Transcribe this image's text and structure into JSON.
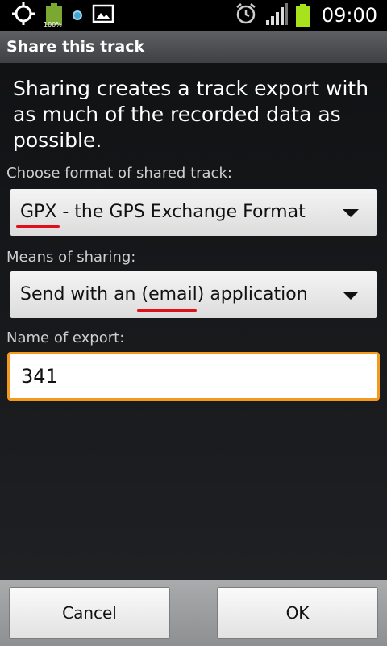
{
  "status_bar": {
    "battery_small_label": "100%",
    "time": "09:00",
    "icons": [
      "gps-icon",
      "battery-full-icon",
      "notification-dot-icon",
      "image-icon",
      "alarm-icon",
      "signal-icon",
      "battery-icon"
    ]
  },
  "dialog": {
    "title": "Share this track",
    "intro": "Sharing creates a track export with as much of the recorded data as possible.",
    "format_label": "Choose format of shared track:",
    "format_value": "GPX - the GPS Exchange Format",
    "means_label": "Means of sharing:",
    "means_value": "Send with an (email) application",
    "name_label": "Name of export:",
    "name_value": "341",
    "cancel": "Cancel",
    "ok": "OK"
  },
  "colors": {
    "input_focus_border": "#f39a1c",
    "underline_annotation": "#e0101a",
    "battery": "#a8e21c"
  }
}
